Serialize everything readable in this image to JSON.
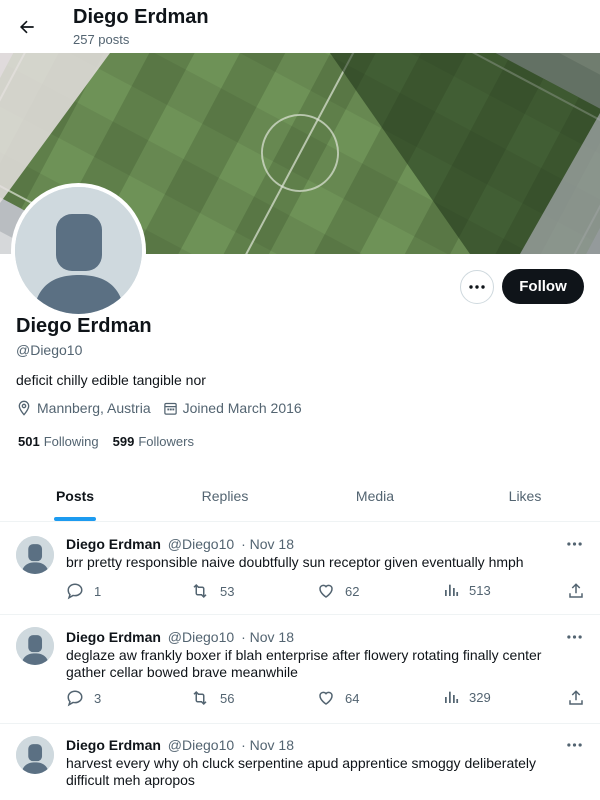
{
  "header": {
    "title": "Diego Erdman",
    "post_count": "257 posts"
  },
  "profile": {
    "name": "Diego Erdman",
    "handle": "@Diego10",
    "bio": "deficit chilly edible tangible nor",
    "location": "Mannberg, Austria",
    "joined": "Joined March 2016",
    "following_count": "501",
    "following_label": "Following",
    "followers_count": "599",
    "followers_label": "Followers",
    "follow_label": "Follow"
  },
  "tabs": [
    {
      "label": "Posts",
      "active": true
    },
    {
      "label": "Replies",
      "active": false
    },
    {
      "label": "Media",
      "active": false
    },
    {
      "label": "Likes",
      "active": false
    }
  ],
  "posts": [
    {
      "name": "Diego Erdman",
      "handle": "@Diego10",
      "date": "Nov 18",
      "text": "brr pretty responsible naive doubtfully sun receptor given eventually hmph",
      "replies": "1",
      "reposts": "53",
      "likes": "62",
      "views": "513"
    },
    {
      "name": "Diego Erdman",
      "handle": "@Diego10",
      "date": "Nov 18",
      "text": "deglaze aw frankly boxer if blah enterprise after flowery rotating finally center gather cellar bowed brave meanwhile",
      "replies": "3",
      "reposts": "56",
      "likes": "64",
      "views": "329"
    },
    {
      "name": "Diego Erdman",
      "handle": "@Diego10",
      "date": "Nov 18",
      "text": "harvest every why oh cluck serpentine apud apprentice smoggy deliberately difficult meh apropos",
      "replies": "",
      "reposts": "",
      "likes": "",
      "views": ""
    }
  ],
  "colors": {
    "accent": "#1d9bf0",
    "text_primary": "#0f1419",
    "text_secondary": "#536471",
    "follow_bg": "#0f1419"
  }
}
